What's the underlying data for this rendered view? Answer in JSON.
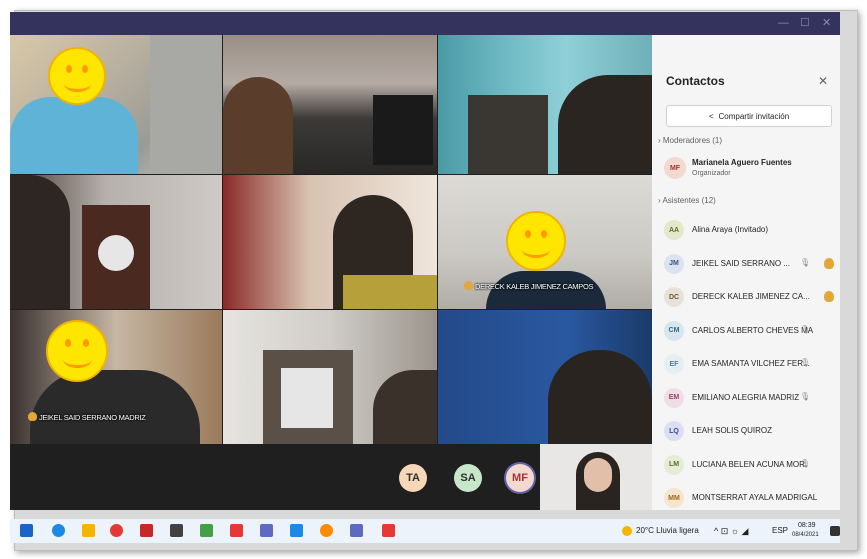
{
  "window": {
    "minimize_glyph": "—",
    "maximize_glyph": "☐",
    "close_glyph": "✕"
  },
  "tiles": {
    "tile5_name": "DERECK KALEB JIMENEZ CAMPOS",
    "tile7_name": "JEIKEL SAID SERRANO MADRIZ"
  },
  "call_bar": {
    "avatars": [
      {
        "initials": "TA",
        "color": "#f6d7b8"
      },
      {
        "initials": "SA",
        "color": "#c8e6c9"
      },
      {
        "initials": "MF",
        "color": "#f3d9d0"
      }
    ]
  },
  "contacts": {
    "title": "Contactos",
    "close_glyph": "✕",
    "share_label": "Compartir invitación",
    "share_icon": "share-icon",
    "moderators_header": "Moderadores (1)",
    "moderator": {
      "initials": "MF",
      "name": "Marianela Aguero Fuentes",
      "role": "Organizador",
      "color": "#f3d9d0",
      "text_color": "#a33"
    },
    "attendees_header": "Asistentes (12)",
    "attendees": [
      {
        "initials": "AA",
        "name": "Alina Araya (Invitado)",
        "color": "#e3e8cc",
        "text_color": "#5a6b1f",
        "mic": false,
        "hand": false
      },
      {
        "initials": "JM",
        "name": "JEIKEL SAID SERRANO ...",
        "color": "#dbe3f0",
        "text_color": "#35508a",
        "mic": true,
        "hand": true
      },
      {
        "initials": "DC",
        "name": "DERECK KALEB JIMENEZ CA...",
        "color": "#e8e1d8",
        "text_color": "#6b5a3a",
        "mic": false,
        "hand": true
      },
      {
        "initials": "CM",
        "name": "CARLOS ALBERTO CHEVES MA",
        "color": "#d6e6ee",
        "text_color": "#2d6a80",
        "mic": true,
        "hand": false
      },
      {
        "initials": "EF",
        "name": "EMA SAMANTA VILCHEZ FER...",
        "color": "#e5eef2",
        "text_color": "#4a7f95",
        "mic": true,
        "hand": false
      },
      {
        "initials": "EM",
        "name": "EMILIANO ALEGRIA MADRIZ",
        "color": "#f1dde6",
        "text_color": "#9a3f6a",
        "mic": true,
        "hand": false
      },
      {
        "initials": "LQ",
        "name": "LEAH SOLIS QUIROZ",
        "color": "#dcdff3",
        "text_color": "#3e46a0",
        "mic": false,
        "hand": false
      },
      {
        "initials": "LM",
        "name": "LUCIANA BELEN ACUNA MOR",
        "color": "#e4ecd6",
        "text_color": "#55702e",
        "mic": true,
        "hand": false
      },
      {
        "initials": "MM",
        "name": "MONTSERRAT AYALA MADRIGAL",
        "color": "#f6e4cc",
        "text_color": "#9a6a1f",
        "mic": false,
        "hand": false
      }
    ]
  },
  "taskbar": {
    "weather": "20°C  Lluvia ligera",
    "lang": "ESP",
    "time": "08:39",
    "date": "08/4/2021"
  }
}
